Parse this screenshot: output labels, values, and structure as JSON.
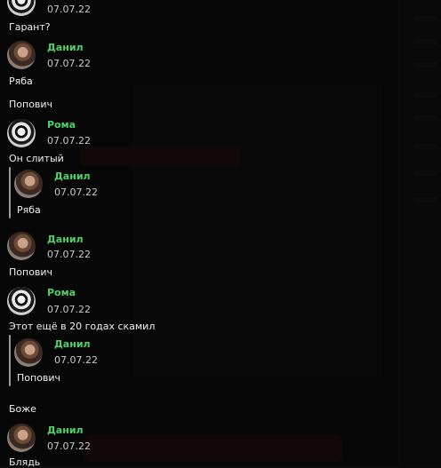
{
  "messages": [
    {
      "type": "header",
      "author": "",
      "time": "07.07.22"
    },
    {
      "type": "text",
      "text": "Гарант?"
    },
    {
      "type": "header",
      "author": "Данил",
      "time": "07.07.22"
    },
    {
      "type": "text",
      "text": "Ряба"
    },
    {
      "type": "text",
      "text": "Попович"
    },
    {
      "type": "header",
      "author": "Рома",
      "time": "07.07.22"
    },
    {
      "type": "text",
      "text": "Он слитый"
    },
    {
      "type": "quote",
      "author": "Данил",
      "time": "07.07.22",
      "text": "Ряба"
    },
    {
      "type": "header",
      "author": "Данил",
      "time": "07.07.22"
    },
    {
      "type": "text",
      "text": "Попович"
    },
    {
      "type": "header",
      "author": "Рома",
      "time": "07.07.22"
    },
    {
      "type": "text",
      "text": "Этот ещё в 20 годах скамил"
    },
    {
      "type": "quote",
      "author": "Данил",
      "time": "07.07.22",
      "text": "Попович"
    },
    {
      "type": "text",
      "text": "Боже"
    },
    {
      "type": "header",
      "author": "Данил",
      "time": "07.07.22"
    },
    {
      "type": "text",
      "text": "Блядь"
    }
  ],
  "colors": {
    "author_name": "#4fd16a",
    "background": "#0b0b0b",
    "text": "#f0f0f0",
    "time": "#c9c9c9"
  }
}
